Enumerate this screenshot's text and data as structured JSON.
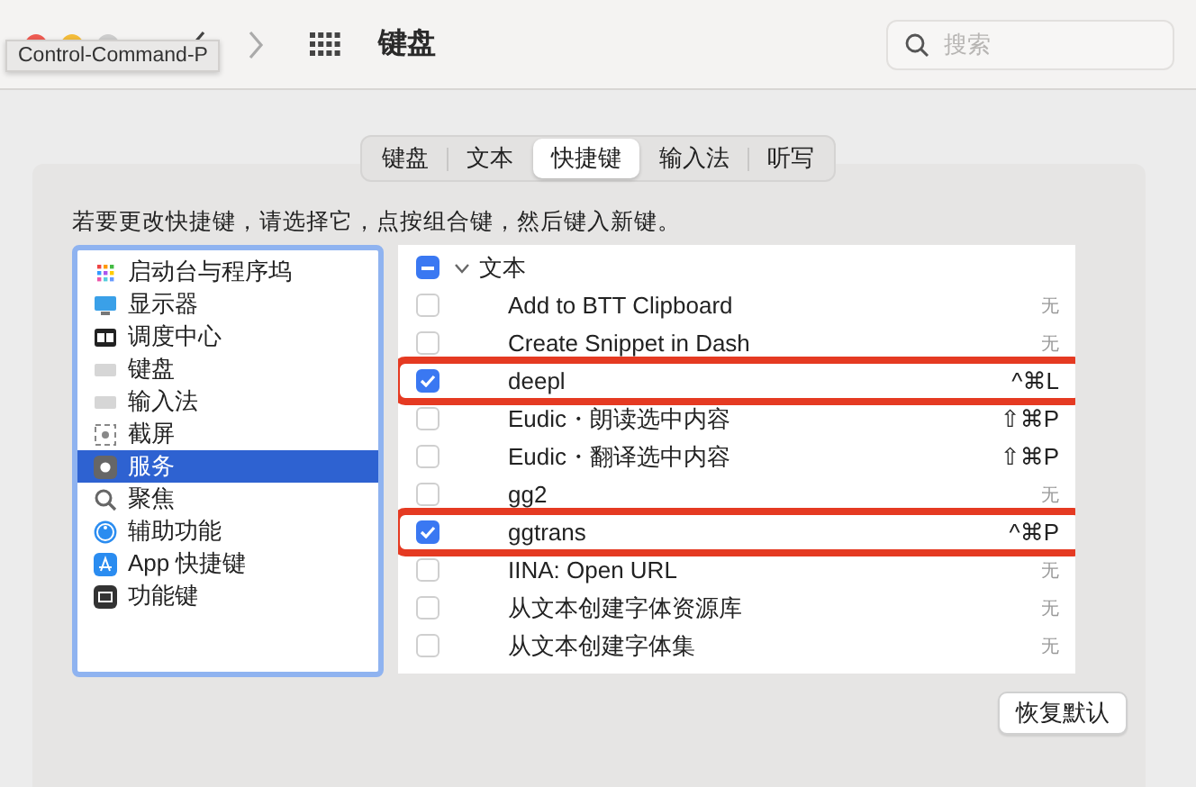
{
  "window": {
    "title": "键盘",
    "search": {
      "placeholder": "搜索"
    }
  },
  "tooltip": "Control-Command-P",
  "tabs": [
    {
      "label": "键盘",
      "selected": false
    },
    {
      "label": "文本",
      "selected": false
    },
    {
      "label": "快捷键",
      "selected": true
    },
    {
      "label": "输入法",
      "selected": false
    },
    {
      "label": "听写",
      "selected": false
    }
  ],
  "instruction": "若要更改快捷键，请选择它，点按组合键，然后键入新键。",
  "categories": [
    {
      "label": "启动台与程序坞",
      "selected": false
    },
    {
      "label": "显示器",
      "selected": false
    },
    {
      "label": "调度中心",
      "selected": false
    },
    {
      "label": "键盘",
      "selected": false
    },
    {
      "label": "输入法",
      "selected": false
    },
    {
      "label": "截屏",
      "selected": false
    },
    {
      "label": "服务",
      "selected": true
    },
    {
      "label": "聚焦",
      "selected": false
    },
    {
      "label": "辅助功能",
      "selected": false
    },
    {
      "label": "App 快捷键",
      "selected": false
    },
    {
      "label": "功能键",
      "selected": false
    }
  ],
  "shortcuts": [
    {
      "kind": "group",
      "label": "文本",
      "checked": true,
      "partial": true,
      "expanded": true
    },
    {
      "kind": "item",
      "label": "Add to BTT Clipboard",
      "shortcut": "无",
      "checked": false,
      "highlighted": false
    },
    {
      "kind": "item",
      "label": "Create Snippet in Dash",
      "shortcut": "无",
      "checked": false,
      "highlighted": false
    },
    {
      "kind": "item",
      "label": "deepl",
      "shortcut": "^⌘L",
      "checked": true,
      "highlighted": true
    },
    {
      "kind": "item",
      "label": "Eudic・朗读选中内容",
      "shortcut": "⇧⌘P",
      "checked": false,
      "highlighted": false
    },
    {
      "kind": "item",
      "label": "Eudic・翻译选中内容",
      "shortcut": "⇧⌘P",
      "checked": false,
      "highlighted": false
    },
    {
      "kind": "item",
      "label": "gg2",
      "shortcut": "无",
      "checked": false,
      "highlighted": false
    },
    {
      "kind": "item",
      "label": "ggtrans",
      "shortcut": "^⌘P",
      "checked": true,
      "highlighted": true
    },
    {
      "kind": "item",
      "label": "IINA: Open URL",
      "shortcut": "无",
      "checked": false,
      "highlighted": false
    },
    {
      "kind": "item",
      "label": "从文本创建字体资源库",
      "shortcut": "无",
      "checked": false,
      "highlighted": false
    },
    {
      "kind": "item",
      "label": "从文本创建字体集",
      "shortcut": "无",
      "checked": false,
      "highlighted": false
    }
  ],
  "reset_button": "恢复默认"
}
